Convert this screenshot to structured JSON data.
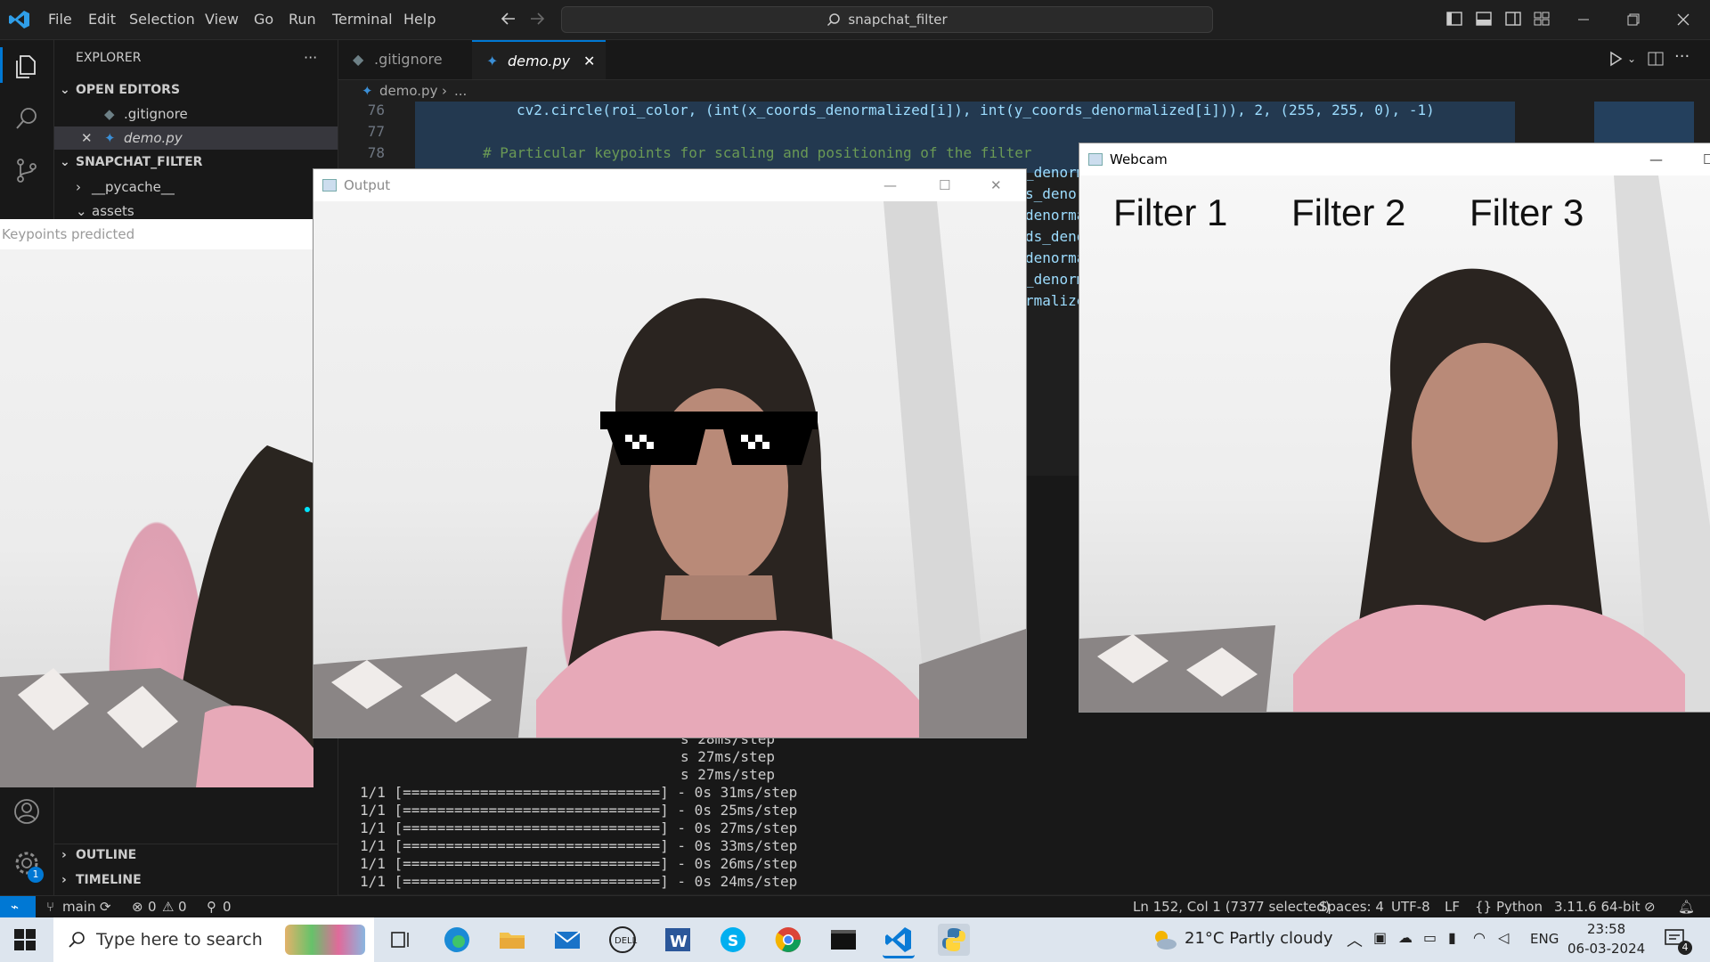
{
  "titlebar": {
    "menu": [
      "File",
      "Edit",
      "Selection",
      "View",
      "Go",
      "Run",
      "Terminal",
      "Help"
    ],
    "search_text": "snapchat_filter"
  },
  "sidebar": {
    "header": "EXPLORER",
    "more": "···",
    "open_editors_label": "OPEN EDITORS",
    "open_editors": [
      ".gitignore",
      "demo.py"
    ],
    "project_label": "SNAPCHAT_FILTER",
    "folders": [
      "__pycache__",
      "assets"
    ],
    "outline_label": "OUTLINE",
    "timeline_label": "TIMELINE"
  },
  "tabs": [
    {
      "label": ".gitignore"
    },
    {
      "label": "demo.py",
      "active": true
    }
  ],
  "breadcrumb": {
    "file": "demo.py",
    "rest": "..."
  },
  "editor": {
    "lines": [
      {
        "num": "76",
        "text": "cv2.circle(roi_color, (int(x_coords_denormalized[i]), int(y_coords_denormalized[i])), 2, (255, 255, 0), -1)"
      },
      {
        "num": "77",
        "text": ""
      },
      {
        "num": "78",
        "text": "# Particular keypoints for scaling and positioning of the filter"
      }
    ],
    "peek_fragments": [
      "_denorm",
      "s_denor",
      "denorma",
      "ds_deno",
      "denorma",
      "_denorm",
      "rmalize"
    ]
  },
  "terminal": {
    "partial_lines": [
      "s 28ms/step",
      "s 27ms/step",
      "s 27ms/step"
    ],
    "lines": [
      "1/1 [==============================] - 0s 31ms/step",
      "1/1 [==============================] - 0s 25ms/step",
      "1/1 [==============================] - 0s 27ms/step",
      "1/1 [==============================] - 0s 33ms/step",
      "1/1 [==============================] - 0s 26ms/step",
      "1/1 [==============================] - 0s 24ms/step"
    ]
  },
  "statusbar": {
    "branch": "main",
    "errors": "0",
    "warnings": "0",
    "ports": "0",
    "position": "Ln 152, Col 1 (7377 selected)",
    "spaces": "Spaces: 4",
    "encoding": "UTF-8",
    "eol": "LF",
    "language": "Python",
    "interpreter": "3.11.6 64-bit",
    "settings_badge": "1"
  },
  "windows": {
    "keypoints_title": "Keypoints predicted",
    "output_title": "Output",
    "webcam_title": "Webcam",
    "filters": [
      "Filter 1",
      "Filter 2",
      "Filter 3"
    ]
  },
  "taskbar": {
    "search_placeholder": "Type here to search",
    "weather": "21°C  Partly cloudy",
    "language": "ENG",
    "time": "23:58",
    "date": "06-03-2024",
    "notification_count": "4"
  },
  "colors": {
    "accent": "#0078d4",
    "editor_bg": "#1f1f1f",
    "taskbar_bg": "#dde5ee"
  }
}
